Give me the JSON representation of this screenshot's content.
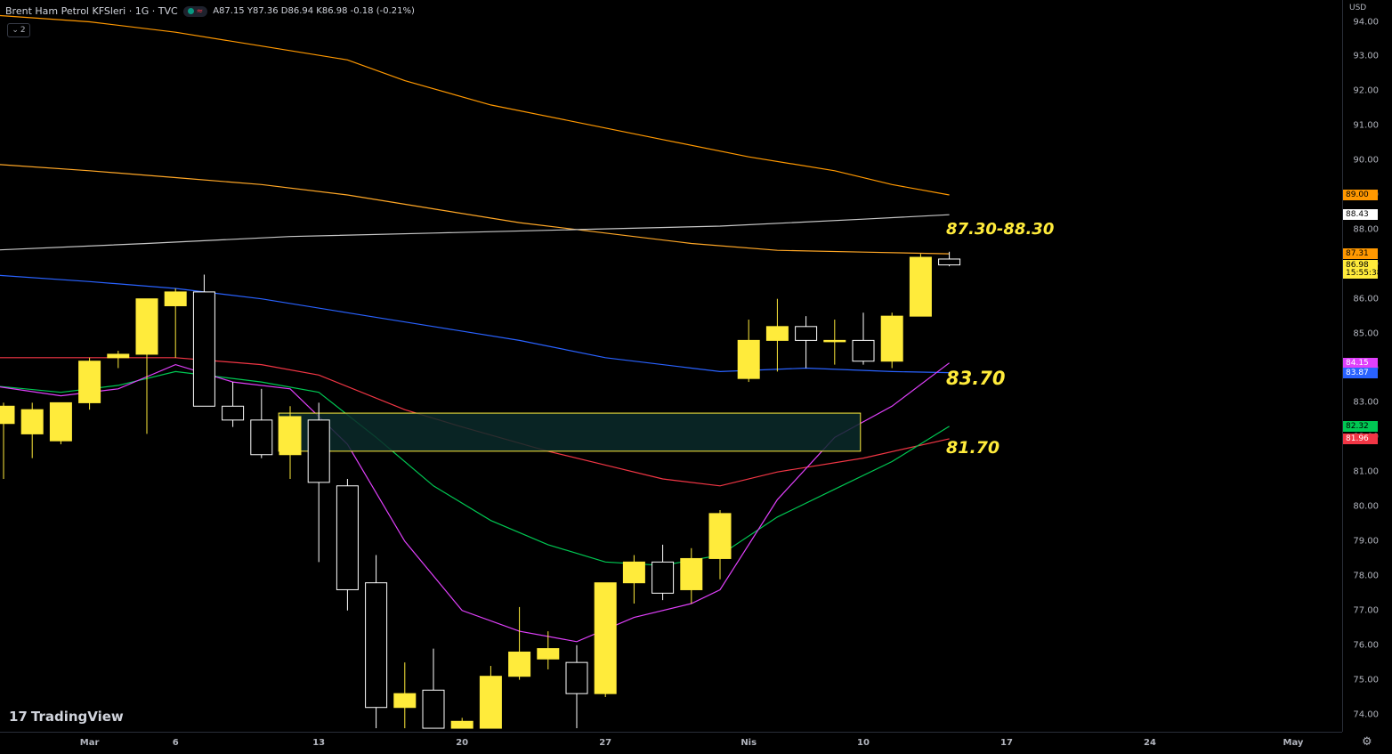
{
  "header": {
    "symbol_title": "Brent Ham Petrol KFSleri · 1G · TVC",
    "ohlc_text": "A87.15 Y87.36 D86.94 K86.98 -0.18 (-0.21%)",
    "collapse_label": "2"
  },
  "price_axis": {
    "currency": "USD",
    "ticks": [
      "94.00",
      "93.00",
      "92.00",
      "91.00",
      "90.00",
      "89.00",
      "88.00",
      "87.00",
      "86.00",
      "85.00",
      "84.00",
      "83.00",
      "82.00",
      "81.00",
      "80.00",
      "79.00",
      "78.00",
      "77.00",
      "76.00",
      "75.00",
      "74.00"
    ]
  },
  "time_axis": {
    "labels": [
      {
        "text": "Mar",
        "i": 3
      },
      {
        "text": "6",
        "i": 6
      },
      {
        "text": "13",
        "i": 11
      },
      {
        "text": "20",
        "i": 16
      },
      {
        "text": "27",
        "i": 21
      },
      {
        "text": "Nis",
        "i": 26
      },
      {
        "text": "10",
        "i": 30
      },
      {
        "text": "17",
        "i": 35
      },
      {
        "text": "24",
        "i": 40
      },
      {
        "text": "May",
        "i": 45
      }
    ]
  },
  "price_tags": [
    {
      "label": "89.00",
      "price": 89.0,
      "bg": "#ff9800",
      "fg": "#000000"
    },
    {
      "label": "88.43",
      "price": 88.43,
      "bg": "#ffffff",
      "fg": "#000000"
    },
    {
      "label": "87.31",
      "price": 87.31,
      "bg": "#ff9800",
      "fg": "#000000"
    },
    {
      "label": "86.98",
      "price": 86.98,
      "bg": "#ffeb3b",
      "fg": "#000000"
    },
    {
      "label": "15:55:38",
      "price": 86.74,
      "bg": "#ffeb3b",
      "fg": "#000000"
    },
    {
      "label": "84.15",
      "price": 84.15,
      "bg": "#e040fb",
      "fg": "#ffffff"
    },
    {
      "label": "83.87",
      "price": 83.87,
      "bg": "#2962ff",
      "fg": "#ffffff"
    },
    {
      "label": "82.32",
      "price": 82.32,
      "bg": "#00c853",
      "fg": "#000000"
    },
    {
      "label": "81.96",
      "price": 81.96,
      "bg": "#f23645",
      "fg": "#ffffff"
    }
  ],
  "annotations": [
    {
      "text": "87.30-88.30",
      "price": 88.0,
      "size": 18
    },
    {
      "text": "83.70",
      "price": 83.7,
      "size": 21
    },
    {
      "text": "81.70",
      "price": 81.7,
      "size": 19
    }
  ],
  "branding": {
    "logo_text": "TradingView"
  },
  "colors": {
    "bull": "#ffeb3b",
    "bear": "#000000",
    "wick": "#ffffff",
    "zone_fill": "#0b2a2a",
    "zone_border": "#ffeb3b"
  },
  "chart_data": {
    "type": "candlestick",
    "y_range": [
      73.6,
      94.1
    ],
    "candles": [
      {
        "o": 82.4,
        "h": 83.0,
        "l": 80.8,
        "c": 82.9
      },
      {
        "o": 82.1,
        "h": 83.0,
        "l": 81.4,
        "c": 82.8
      },
      {
        "o": 81.9,
        "h": 83.0,
        "l": 81.8,
        "c": 83.0
      },
      {
        "o": 83.0,
        "h": 84.3,
        "l": 82.8,
        "c": 84.2
      },
      {
        "o": 84.3,
        "h": 84.5,
        "l": 84.0,
        "c": 84.4
      },
      {
        "o": 84.4,
        "h": 86.0,
        "l": 82.1,
        "c": 86.0
      },
      {
        "o": 85.8,
        "h": 86.3,
        "l": 84.3,
        "c": 86.2
      },
      {
        "o": 86.2,
        "h": 86.7,
        "l": 82.9,
        "c": 82.9
      },
      {
        "o": 82.9,
        "h": 83.6,
        "l": 82.3,
        "c": 82.5
      },
      {
        "o": 82.5,
        "h": 83.4,
        "l": 81.4,
        "c": 81.5
      },
      {
        "o": 81.5,
        "h": 82.9,
        "l": 80.8,
        "c": 82.6
      },
      {
        "o": 82.5,
        "h": 83.0,
        "l": 78.4,
        "c": 80.7
      },
      {
        "o": 80.6,
        "h": 80.8,
        "l": 77.0,
        "c": 77.6
      },
      {
        "o": 77.8,
        "h": 78.6,
        "l": 73.6,
        "c": 74.2
      },
      {
        "o": 74.2,
        "h": 75.5,
        "l": 73.6,
        "c": 74.6
      },
      {
        "o": 74.7,
        "h": 75.9,
        "l": 73.6,
        "c": 73.6
      },
      {
        "o": 73.6,
        "h": 73.9,
        "l": 73.6,
        "c": 73.8
      },
      {
        "o": 73.6,
        "h": 75.4,
        "l": 73.6,
        "c": 75.1
      },
      {
        "o": 75.1,
        "h": 77.1,
        "l": 75.0,
        "c": 75.8
      },
      {
        "o": 75.6,
        "h": 76.4,
        "l": 75.3,
        "c": 75.9
      },
      {
        "o": 75.5,
        "h": 76.0,
        "l": 73.6,
        "c": 74.6
      },
      {
        "o": 74.6,
        "h": 77.8,
        "l": 74.5,
        "c": 77.8
      },
      {
        "o": 77.8,
        "h": 78.6,
        "l": 77.2,
        "c": 78.4
      },
      {
        "o": 78.4,
        "h": 78.9,
        "l": 77.3,
        "c": 77.5
      },
      {
        "o": 77.6,
        "h": 78.8,
        "l": 77.2,
        "c": 78.5
      },
      {
        "o": 78.5,
        "h": 79.9,
        "l": 77.9,
        "c": 79.8
      },
      {
        "o": 83.7,
        "h": 85.4,
        "l": 83.6,
        "c": 84.8
      },
      {
        "o": 84.8,
        "h": 86.0,
        "l": 83.9,
        "c": 85.2
      },
      {
        "o": 85.2,
        "h": 85.5,
        "l": 84.0,
        "c": 84.8
      },
      {
        "o": 84.8,
        "h": 85.4,
        "l": 84.1,
        "c": 84.8
      },
      {
        "o": 84.8,
        "h": 85.6,
        "l": 84.1,
        "c": 84.2
      },
      {
        "o": 84.2,
        "h": 85.6,
        "l": 84.0,
        "c": 85.5
      },
      {
        "o": 85.5,
        "h": 87.3,
        "l": 85.5,
        "c": 87.2
      },
      {
        "o": 87.15,
        "h": 87.36,
        "l": 86.94,
        "c": 86.98
      }
    ],
    "series": [
      {
        "color": "#ff9800",
        "points": [
          [
            -0.5,
            94.2
          ],
          [
            3,
            94.0
          ],
          [
            6,
            93.7
          ],
          [
            9,
            93.3
          ],
          [
            12,
            92.9
          ],
          [
            14,
            92.3
          ],
          [
            17,
            91.6
          ],
          [
            20,
            91.1
          ],
          [
            23,
            90.6
          ],
          [
            26,
            90.1
          ],
          [
            29,
            89.7
          ],
          [
            31,
            89.3
          ],
          [
            33,
            89.0
          ]
        ]
      },
      {
        "color": "#ffa726",
        "points": [
          [
            -0.5,
            89.9
          ],
          [
            3,
            89.7
          ],
          [
            6,
            89.5
          ],
          [
            9,
            89.3
          ],
          [
            12,
            89.0
          ],
          [
            15,
            88.6
          ],
          [
            18,
            88.2
          ],
          [
            21,
            87.9
          ],
          [
            24,
            87.6
          ],
          [
            27,
            87.4
          ],
          [
            30,
            87.35
          ],
          [
            33,
            87.3
          ]
        ]
      },
      {
        "color": "#c8c8c8",
        "points": [
          [
            -0.5,
            87.4
          ],
          [
            5,
            87.6
          ],
          [
            10,
            87.8
          ],
          [
            15,
            87.9
          ],
          [
            20,
            88.0
          ],
          [
            25,
            88.1
          ],
          [
            30,
            88.3
          ],
          [
            33,
            88.43
          ]
        ]
      },
      {
        "color": "#2962ff",
        "points": [
          [
            -0.5,
            86.7
          ],
          [
            3,
            86.5
          ],
          [
            6,
            86.3
          ],
          [
            9,
            86.0
          ],
          [
            12,
            85.6
          ],
          [
            15,
            85.2
          ],
          [
            18,
            84.8
          ],
          [
            21,
            84.3
          ],
          [
            24,
            84.0
          ],
          [
            25,
            83.9
          ],
          [
            28,
            84.0
          ],
          [
            31,
            83.9
          ],
          [
            33,
            83.87
          ]
        ]
      },
      {
        "color": "#f23645",
        "points": [
          [
            -0.5,
            84.3
          ],
          [
            2,
            84.3
          ],
          [
            6,
            84.3
          ],
          [
            9,
            84.1
          ],
          [
            11,
            83.8
          ],
          [
            14,
            82.8
          ],
          [
            16,
            82.3
          ],
          [
            19,
            81.6
          ],
          [
            21,
            81.2
          ],
          [
            23,
            80.8
          ],
          [
            25,
            80.6
          ],
          [
            27,
            81.0
          ],
          [
            30,
            81.4
          ],
          [
            33,
            81.96
          ]
        ]
      },
      {
        "color": "#00c853",
        "points": [
          [
            -0.5,
            83.5
          ],
          [
            2,
            83.3
          ],
          [
            4,
            83.5
          ],
          [
            6,
            83.9
          ],
          [
            9,
            83.6
          ],
          [
            11,
            83.3
          ],
          [
            13,
            82.0
          ],
          [
            15,
            80.6
          ],
          [
            17,
            79.6
          ],
          [
            19,
            78.9
          ],
          [
            21,
            78.4
          ],
          [
            23,
            78.3
          ],
          [
            25,
            78.6
          ],
          [
            27,
            79.7
          ],
          [
            29,
            80.5
          ],
          [
            31,
            81.3
          ],
          [
            33,
            82.32
          ]
        ]
      },
      {
        "color": "#e040fb",
        "points": [
          [
            -0.5,
            83.5
          ],
          [
            2,
            83.2
          ],
          [
            4,
            83.4
          ],
          [
            6,
            84.1
          ],
          [
            8,
            83.6
          ],
          [
            10,
            83.4
          ],
          [
            12,
            81.8
          ],
          [
            14,
            79.0
          ],
          [
            16,
            77.0
          ],
          [
            18,
            76.4
          ],
          [
            20,
            76.1
          ],
          [
            22,
            76.8
          ],
          [
            24,
            77.2
          ],
          [
            25,
            77.6
          ],
          [
            27,
            80.2
          ],
          [
            29,
            82.0
          ],
          [
            31,
            82.9
          ],
          [
            33,
            84.15
          ]
        ]
      }
    ],
    "zones": [
      {
        "x0": 9.6,
        "x1": 29.9,
        "y0": 81.6,
        "y1": 82.7
      }
    ]
  }
}
